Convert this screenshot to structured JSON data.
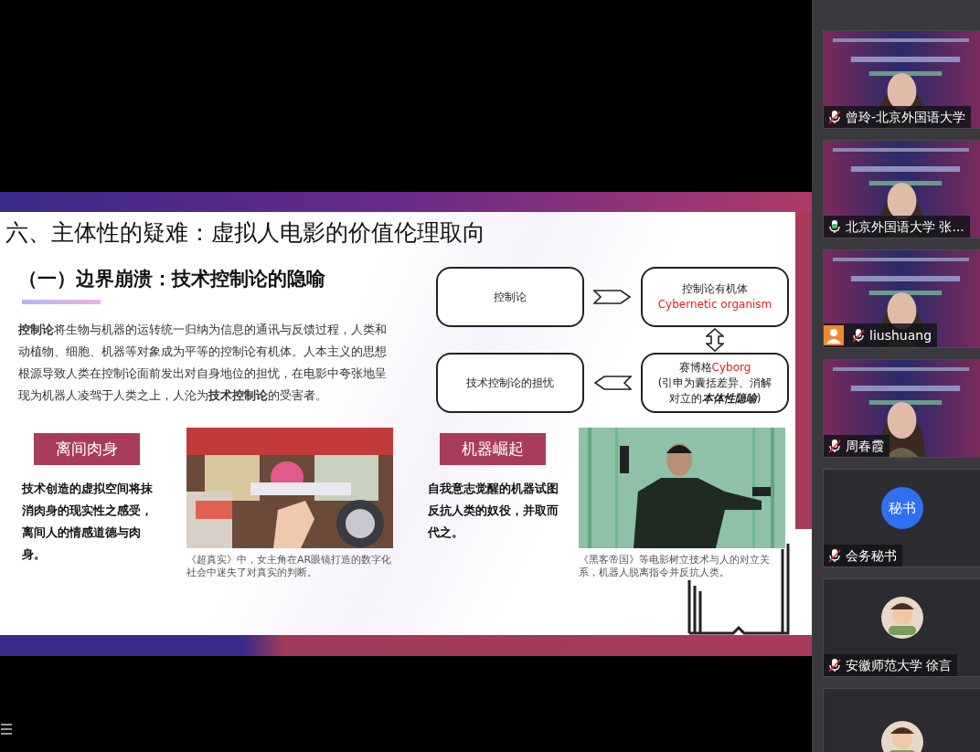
{
  "slide": {
    "title": "六、主体性的疑难：虚拟人电影的价值伦理取向",
    "subtitle": "（一）边界崩溃：技术控制论的隐喻",
    "paragraph": "**控制论**将生物与机器的运转统一归纳为信息的通讯与反馈过程，人类和动植物、细胞、机器等对象成为平等的控制论有机体。人本主义的思想根源导致人类在控制论面前发出对自身地位的担忧，在电影中夸张地呈现为机器人凌驾于人类之上，人沦为**技术控制论**的受害者。",
    "diagram": [
      {
        "lines": [
          [
            {
              "text": "控制论",
              "accent": false
            }
          ]
        ]
      },
      {
        "lines": [
          [
            {
              "text": "控制论有机体",
              "accent": false
            }
          ],
          [
            {
              "text": "Cybernetic organism",
              "accent": true
            }
          ]
        ]
      },
      {
        "lines": [
          [
            {
              "text": "技术控制论的担忧",
              "accent": false
            }
          ]
        ]
      },
      {
        "lines": [
          [
            {
              "text": "赛博格",
              "accent": false
            },
            {
              "text": "Cyborg",
              "accent": true
            }
          ],
          [
            {
              "text": "(引申为囊括差异、消解",
              "accent": false
            }
          ],
          [
            {
              "text": "对立的",
              "accent": false
            },
            {
              "text": "本体性隐喻",
              "accent": false,
              "emphasis": true
            },
            {
              "text": ")",
              "accent": false
            }
          ]
        ]
      }
    ],
    "sections": [
      {
        "label": "离间肉身",
        "text": "技术创造的虚拟空间将抹消肉身的现实性之感受，离间人的情感道德与肉身。",
        "caption": "《超真实》中，女主角在AR眼镜打造的数字化社会中迷失了对真实的判断。"
      },
      {
        "label": "机器崛起",
        "text": "自我意志觉醒的机器试图反抗人类的奴役，并取而代之。",
        "caption": "《黑客帝国》等电影树立技术与人的对立关系，机器人脱离指令并反抗人类。"
      }
    ]
  },
  "participants": [
    {
      "name": "曾玲-北京外国语大学",
      "muted": true,
      "kind": "video",
      "host_icon": false
    },
    {
      "name": "北京外国语大学 张...",
      "muted": false,
      "kind": "video",
      "host_icon": false
    },
    {
      "name": "liushuang",
      "muted": true,
      "kind": "video",
      "host_icon": true
    },
    {
      "name": "周春霞",
      "muted": true,
      "kind": "video",
      "host_icon": false
    },
    {
      "name": "会务秘书",
      "muted": true,
      "kind": "initials",
      "initials": "秘书",
      "host_icon": false
    },
    {
      "name": "安徽师范大学 徐言",
      "muted": true,
      "kind": "avatar",
      "host_icon": false
    },
    {
      "kind": "avatar"
    }
  ]
}
